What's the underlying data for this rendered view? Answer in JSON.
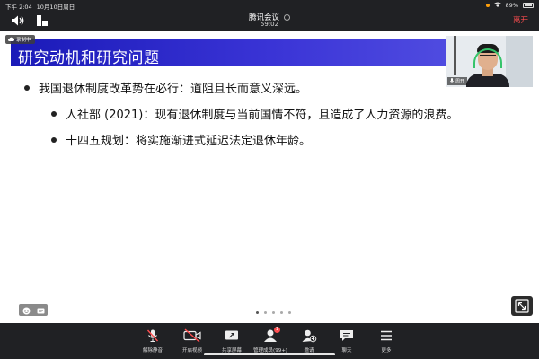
{
  "status_bar": {
    "time": "下午 2:04",
    "date": "10月10日周日",
    "battery": "89%"
  },
  "top_bar": {
    "meeting_title": "腾讯会议",
    "timer": "59:02",
    "leave_label": "离开"
  },
  "recording_label": "录制中",
  "slide": {
    "title": "研究动机和研究问题",
    "bullets": [
      "我国退休制度改革势在必行：道阻且长而意义深远。",
      "人社部 (2021)：现有退休制度与当前国情不符，且造成了人力资源的浪费。",
      "十四五规划：将实施渐进式延迟法定退休年龄。"
    ]
  },
  "self_video": {
    "name": "周开"
  },
  "toolbar": {
    "unmute": "解除静音",
    "start_video": "开启视频",
    "share_screen": "共享屏幕",
    "participants": "管理成员(99+)",
    "invite": "邀请",
    "chat": "聊天",
    "more": "更多",
    "participants_badge": "1"
  },
  "colors": {
    "title_bar": "#2a25c8",
    "leave": "#ff4d4f",
    "toolbar_bg": "#202124",
    "mute_red": "#ff4d4f"
  }
}
